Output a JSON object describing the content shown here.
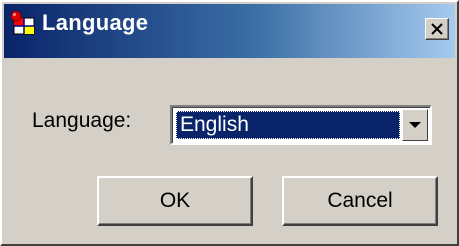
{
  "window": {
    "title": "Language",
    "icon": "app-flag-icon",
    "close_icon": "close-x-icon"
  },
  "form": {
    "language_label": "Language:",
    "language_value": "English"
  },
  "buttons": {
    "ok_label": "OK",
    "cancel_label": "Cancel"
  },
  "colors": {
    "titlebar_start": "#0a246a",
    "titlebar_end": "#a6caf0",
    "dialog_face": "#d4d0c8",
    "selection": "#0a246a"
  }
}
